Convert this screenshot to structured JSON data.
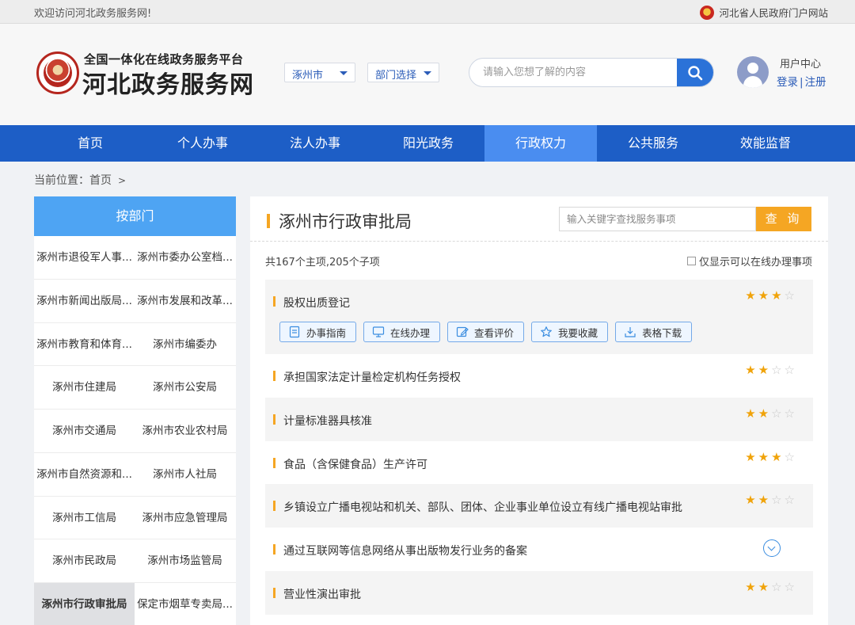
{
  "topbar": {
    "welcome": "欢迎访问河北政务服务网!",
    "portal_link": "河北省人民政府门户网站"
  },
  "header": {
    "brand_sub": "全国一体化在线政务服务平台",
    "brand_main": "河北政务服务网",
    "city_select": "涿州市",
    "dept_select": "部门选择",
    "search_placeholder": "请输入您想了解的内容",
    "user_center": "用户中心",
    "login": "登录",
    "register": "注册"
  },
  "nav": [
    "首页",
    "个人办事",
    "法人办事",
    "阳光政务",
    "行政权力",
    "公共服务",
    "效能监督"
  ],
  "nav_active": "行政权力",
  "breadcrumb": {
    "label": "当前位置：",
    "current": "首页",
    "arrow": ">"
  },
  "left_panel": {
    "title": "按部门",
    "departments": [
      [
        "涿州市退役军人事...",
        "涿州市委办公室档..."
      ],
      [
        "涿州市新闻出版局...",
        "涿州市发展和改革..."
      ],
      [
        "涿州市教育和体育...",
        "涿州市编委办"
      ],
      [
        "涿州市住建局",
        "涿州市公安局"
      ],
      [
        "涿州市交通局",
        "涿州市农业农村局"
      ],
      [
        "涿州市自然资源和...",
        "涿州市人社局"
      ],
      [
        "涿州市工信局",
        "涿州市应急管理局"
      ],
      [
        "涿州市民政局",
        "涿州市场监管局"
      ],
      [
        "涿州市行政审批局",
        "保定市烟草专卖局..."
      ]
    ],
    "active": "涿州市行政审批局"
  },
  "main": {
    "title": "涿州市行政审批局",
    "keyword_placeholder": "输入关键字查找服务事项",
    "query_button": "查 询",
    "count_text": "共167个主项,205个子项",
    "online_only_label": "仅显示可以在线办理事项",
    "actions": [
      "办事指南",
      "在线办理",
      "查看评价",
      "我要收藏",
      "表格下载"
    ],
    "items": [
      {
        "name": "股权出质登记",
        "stars": 3,
        "expanded": true
      },
      {
        "name": "承担国家法定计量检定机构任务授权",
        "stars": 2
      },
      {
        "name": "计量标准器具核准",
        "stars": 2
      },
      {
        "name": "食品（含保健食品）生产许可",
        "stars": 3
      },
      {
        "name": "乡镇设立广播电视站和机关、部队、团体、企业事业单位设立有线广播电视站审批",
        "stars": 2
      },
      {
        "name": "通过互联网等信息网络从事出版物发行业务的备案",
        "stars": null
      },
      {
        "name": "营业性演出审批",
        "stars": 2
      }
    ]
  },
  "colors": {
    "nav_bg": "#1d5ec6",
    "nav_active": "#4a8df0",
    "accent": "#f5a623",
    "left_head": "#4ea4f3",
    "link": "#2b5cb8"
  }
}
